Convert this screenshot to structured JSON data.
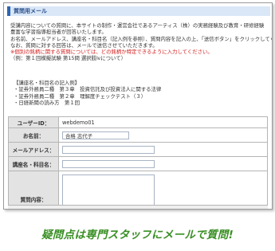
{
  "header": {
    "title": "質問用メール"
  },
  "intro": [
    "受講内容についての質問に、本サイトの制作・運営会社であるアーティス（株）の実務経験及び教育・研修経験",
    "豊富な学習指導担当者が回答いたします。",
    "お名前、メールアドレス、講座名・科目名（記入例を参照）、質問内容を記入の上、「送信ボタン」をクリックしてください。",
    "なお、質問に対する回答は、メールで送信させていただきます。"
  ],
  "warning": "※個別の銘柄に関する質問については、どの銘柄か特定できるように入力してください。",
  "example_note": "（例：第１回模擬試験 第15問 選択肢ⅳについて）",
  "examples": [
    "【講座名・科目名の記入例】",
    "・証券外務員二種　第３章　投資信託及び投資法人に関する法律",
    "・証券外務員二種　第２章　理解度チェックテスト（３）",
    "・日経新聞の読み方　第１回"
  ],
  "form": {
    "user_id_label": "ユーザーID：",
    "user_id_value": "webdemo01",
    "name_label": "お名前：",
    "name_value": "合格 志代子",
    "email_label": "メールアドレス：",
    "email_value": "",
    "subject_label": "講座名・科目名：",
    "subject_value": "",
    "body_label": "質問内容："
  },
  "caption": "疑問点は専門スタッフにメールで質問!"
}
